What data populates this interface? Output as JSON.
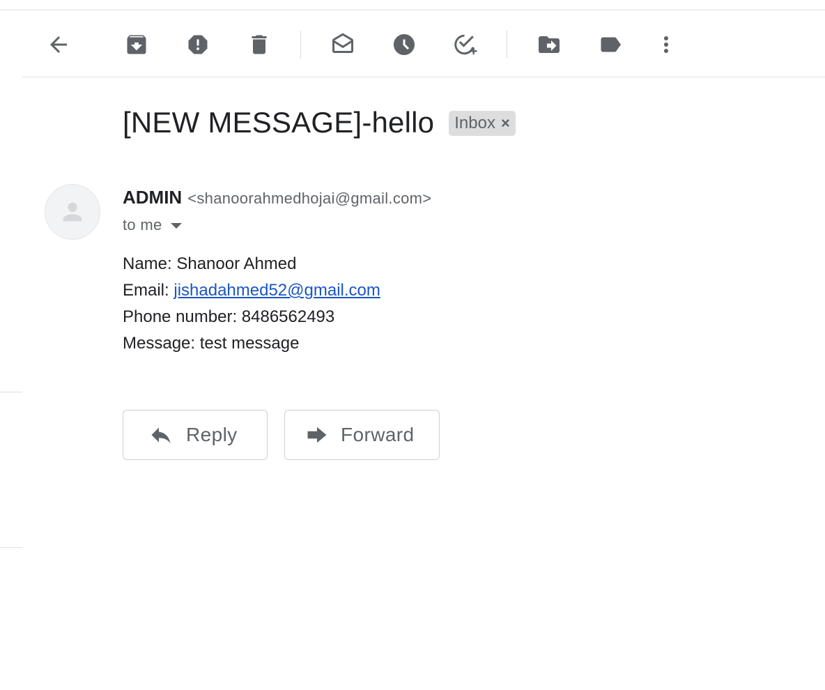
{
  "toolbar": {
    "buttons": [
      {
        "name": "back-button",
        "icon": "back-arrow-icon"
      },
      {
        "name": "archive-button",
        "icon": "archive-icon"
      },
      {
        "name": "report-spam-button",
        "icon": "report-spam-icon"
      },
      {
        "name": "delete-button",
        "icon": "trash-icon"
      },
      {
        "name": "mark-unread-button",
        "icon": "mark-unread-icon"
      },
      {
        "name": "snooze-button",
        "icon": "clock-icon"
      },
      {
        "name": "add-to-tasks-button",
        "icon": "add-task-icon"
      },
      {
        "name": "move-to-button",
        "icon": "move-to-icon"
      },
      {
        "name": "labels-button",
        "icon": "label-icon"
      },
      {
        "name": "more-button",
        "icon": "more-vert-icon"
      }
    ]
  },
  "message": {
    "subject": "[NEW MESSAGE]-hello",
    "label": "Inbox",
    "label_remove": "×",
    "sender_name": "ADMIN",
    "sender_email": "<shanoorahmedhojai@gmail.com>",
    "recipient": "to me",
    "body": {
      "name_line": "Name: Shanoor Ahmed",
      "email_prefix": "Email: ",
      "email_link": "jishadahmed52@gmail.com",
      "phone_line": "Phone number: 8486562493",
      "message_line": "Message: test message"
    }
  },
  "actions": {
    "reply_label": "Reply",
    "forward_label": "Forward"
  },
  "colors": {
    "icon_gray": "#5f6368",
    "link_blue": "#1a55c5",
    "chip_bg": "#dddddd"
  }
}
